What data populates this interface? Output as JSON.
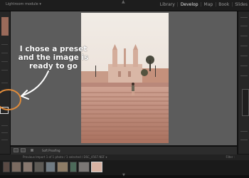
{
  "window": {
    "title": "Lightroom module ▾"
  },
  "modules": [
    "Library",
    "Develop",
    "Map",
    "Book",
    "Slides"
  ],
  "active_module": "Develop",
  "annotation": {
    "text": "I chose a preset\nand the image is\nready to go"
  },
  "toolbar": {
    "soft_proofing_label": "Soft Proofing"
  },
  "filmstrip": {
    "path_label": "Previous Import   1 of 1 photo / 1 selected / DSC_4567.NEF ▾",
    "filter_label": "Filter :",
    "selected_index": 8,
    "thumbs": [
      {
        "bg": "#5a4a44"
      },
      {
        "bg": "#7a6a60"
      },
      {
        "bg": "#87776e"
      },
      {
        "bg": "#5d5a55"
      },
      {
        "bg": "#6f7a82"
      },
      {
        "bg": "#8d7c66"
      },
      {
        "bg": "#4d6a5a"
      },
      {
        "bg": "#7b7775"
      },
      {
        "bg": "#d9b3a3"
      }
    ]
  },
  "colors": {
    "accent": "#e08b3a",
    "panel": "#262626",
    "canvas": "#5c5c5c"
  }
}
